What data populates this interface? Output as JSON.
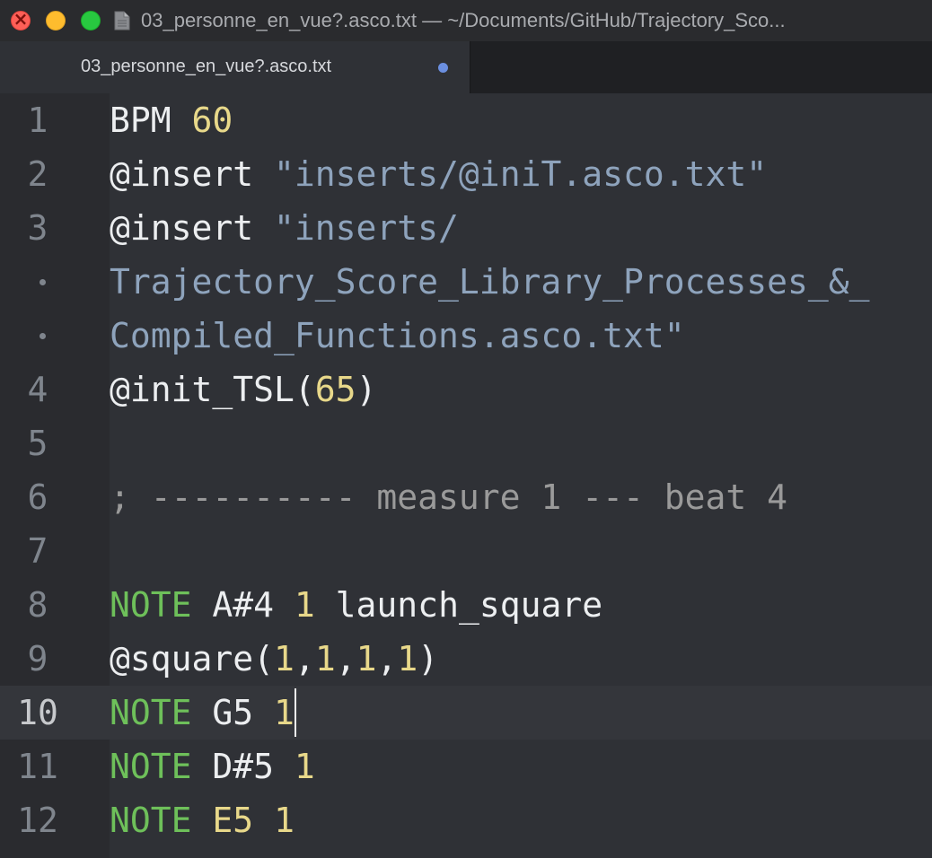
{
  "window": {
    "title": "03_personne_en_vue?.asco.txt — ~/Documents/GitHub/Trajectory_Sco..."
  },
  "tab": {
    "label": "03_personne_en_vue?.asco.txt",
    "modified": true
  },
  "colors": {
    "background": "#2f3136",
    "keyword_note": "#6ec05a",
    "number": "#e8d88a",
    "string": "#8ea3bc",
    "comment": "#9a9a9a",
    "modified_dot": "#6b8fe0"
  },
  "editor": {
    "current_line": "10",
    "lines": [
      {
        "gutter": "1",
        "t1": "BPM ",
        "t2": "60"
      },
      {
        "gutter": "2",
        "t1": "@insert ",
        "t2": "\"inserts/@iniT.asco.txt\""
      },
      {
        "gutter": "3",
        "t1": "@insert ",
        "t2": "\"inserts/"
      },
      {
        "gutter": "",
        "t1": "Trajectory_Score_Library_Processes_&_"
      },
      {
        "gutter": "",
        "t1": "Compiled_Functions.asco.txt\""
      },
      {
        "gutter": "4",
        "t1": "@init_TSL",
        "t2": "(",
        "t3": "65",
        "t4": ")"
      },
      {
        "gutter": "5"
      },
      {
        "gutter": "6",
        "t1": "; ---------- measure 1 --- beat 4"
      },
      {
        "gutter": "7"
      },
      {
        "gutter": "8",
        "t1": "NOTE",
        "t2": " A#4 ",
        "t3": "1",
        "t4": " launch_square"
      },
      {
        "gutter": "9",
        "t1": "@square",
        "t2": "(",
        "t3": "1",
        "t4": ",",
        "t5": "1",
        "t6": ",",
        "t7": "1",
        "t8": ",",
        "t9": "1",
        "t10": ")"
      },
      {
        "gutter": "10",
        "t1": "NOTE",
        "t2": " G5 ",
        "t3": "1"
      },
      {
        "gutter": "11",
        "t1": "NOTE",
        "t2": " D#5 ",
        "t3": "1"
      },
      {
        "gutter": "12",
        "t1": "NOTE",
        "t2": " ",
        "t3": "E5",
        "t4": " ",
        "t5": "1"
      }
    ]
  }
}
